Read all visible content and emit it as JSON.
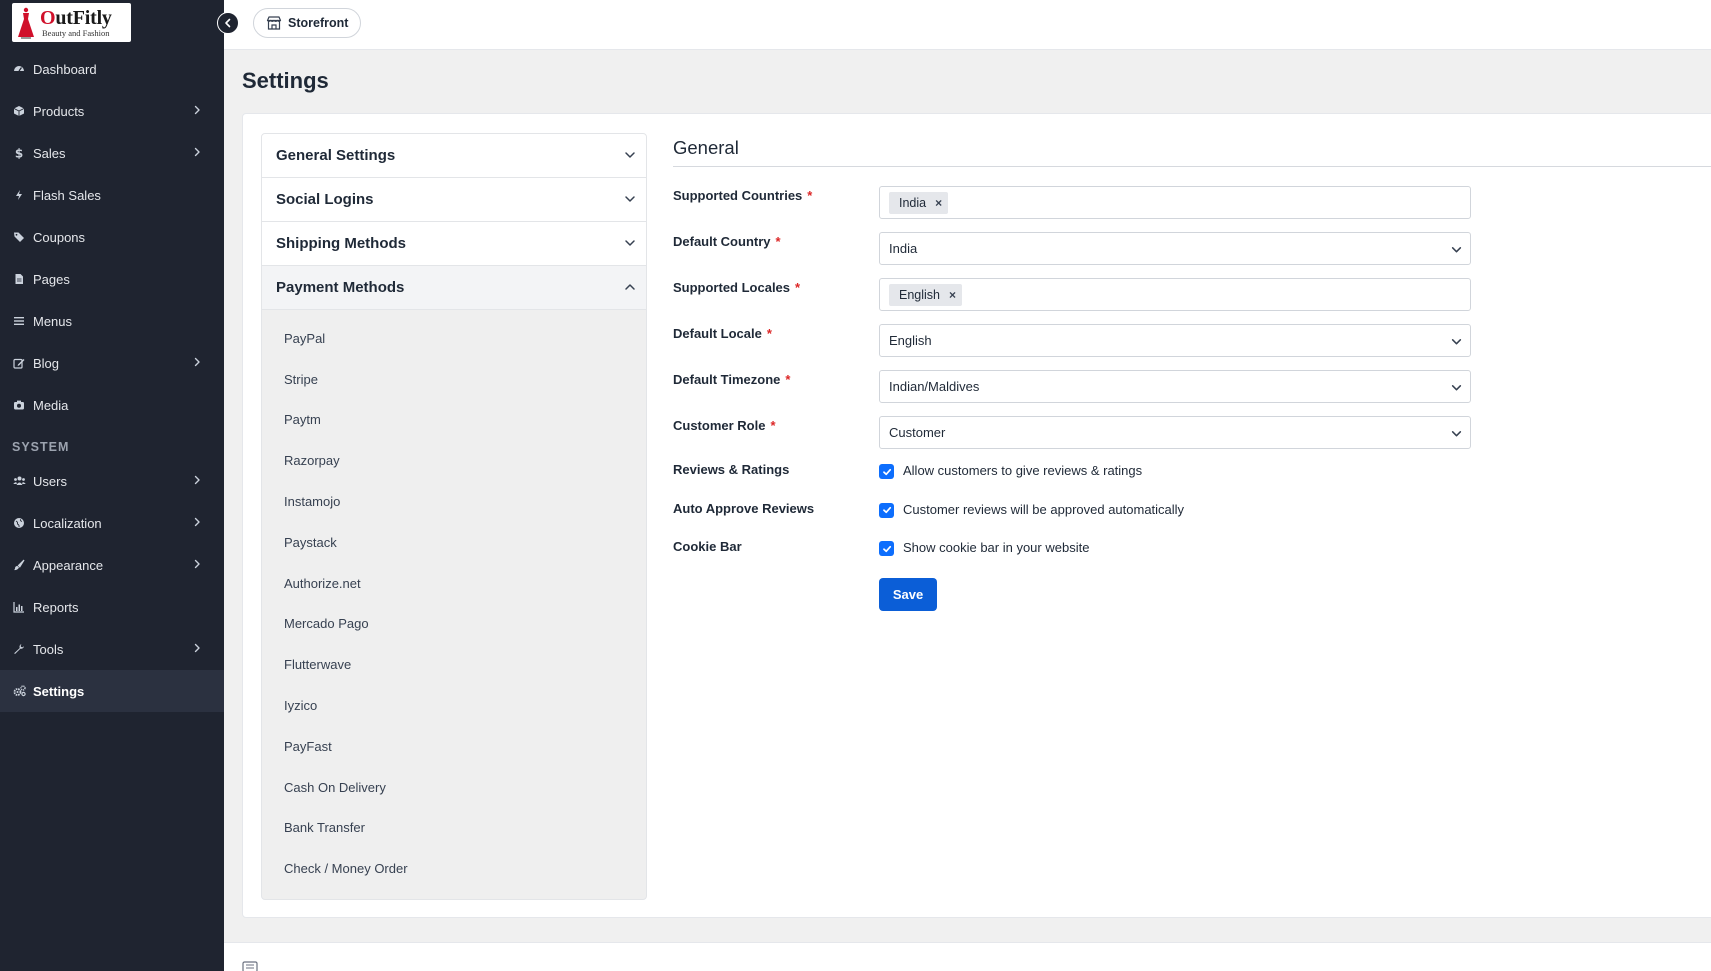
{
  "brand": {
    "name_first": "O",
    "name_rest": "utFitly",
    "tagline": "Beauty and Fashion"
  },
  "topbar": {
    "storefront_label": "Storefront"
  },
  "sidebar": {
    "items": [
      {
        "label": "Dashboard",
        "icon": "dashboard-icon",
        "has_children": false
      },
      {
        "label": "Products",
        "icon": "cube-icon",
        "has_children": true
      },
      {
        "label": "Sales",
        "icon": "dollar-icon",
        "has_children": true
      },
      {
        "label": "Flash Sales",
        "icon": "bolt-icon",
        "has_children": false
      },
      {
        "label": "Coupons",
        "icon": "tags-icon",
        "has_children": false
      },
      {
        "label": "Pages",
        "icon": "file-icon",
        "has_children": false
      },
      {
        "label": "Menus",
        "icon": "bars-icon",
        "has_children": false
      },
      {
        "label": "Blog",
        "icon": "edit-icon",
        "has_children": true
      },
      {
        "label": "Media",
        "icon": "camera-icon",
        "has_children": false
      }
    ],
    "section_system": "SYSTEM",
    "system_items": [
      {
        "label": "Users",
        "icon": "users-icon",
        "has_children": true
      },
      {
        "label": "Localization",
        "icon": "globe-icon",
        "has_children": true
      },
      {
        "label": "Appearance",
        "icon": "brush-icon",
        "has_children": true
      },
      {
        "label": "Reports",
        "icon": "chart-icon",
        "has_children": false
      },
      {
        "label": "Tools",
        "icon": "wrench-icon",
        "has_children": true
      },
      {
        "label": "Settings",
        "icon": "cogs-icon",
        "has_children": false,
        "active": true
      }
    ]
  },
  "page": {
    "title": "Settings"
  },
  "accordion": {
    "sections": [
      {
        "label": "General Settings",
        "open": false
      },
      {
        "label": "Social Logins",
        "open": false
      },
      {
        "label": "Shipping Methods",
        "open": false
      },
      {
        "label": "Payment Methods",
        "open": true
      }
    ],
    "payment_methods": [
      "PayPal",
      "Stripe",
      "Paytm",
      "Razorpay",
      "Instamojo",
      "Paystack",
      "Authorize.net",
      "Mercado Pago",
      "Flutterwave",
      "Iyzico",
      "PayFast",
      "Cash On Delivery",
      "Bank Transfer",
      "Check / Money Order"
    ]
  },
  "form": {
    "title": "General",
    "supported_countries": {
      "label": "Supported Countries",
      "tags": [
        "India"
      ]
    },
    "default_country": {
      "label": "Default Country",
      "value": "India"
    },
    "supported_locales": {
      "label": "Supported Locales",
      "tags": [
        "English"
      ]
    },
    "default_locale": {
      "label": "Default Locale",
      "value": "English"
    },
    "default_timezone": {
      "label": "Default Timezone",
      "value": "Indian/Maldives"
    },
    "customer_role": {
      "label": "Customer Role",
      "value": "Customer"
    },
    "reviews": {
      "label": "Reviews & Ratings",
      "text": "Allow customers to give reviews & ratings",
      "checked": true
    },
    "auto_approve": {
      "label": "Auto Approve Reviews",
      "text": "Customer reviews will be approved automatically",
      "checked": true
    },
    "cookie_bar": {
      "label": "Cookie Bar",
      "text": "Show cookie bar in your website",
      "checked": true
    },
    "required_mark": "*",
    "tag_remove": "×",
    "save_label": "Save"
  },
  "colors": {
    "sidebar_bg": "#1f2430",
    "primary": "#0b5ed7",
    "required": "#dc2626"
  }
}
